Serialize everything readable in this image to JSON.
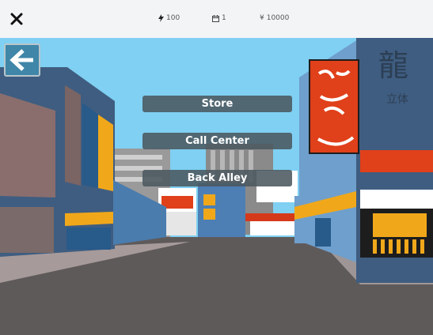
{
  "topbar": {
    "close_icon": "close-icon",
    "stats": [
      {
        "icon": "energy-bolt-icon",
        "value": "100"
      },
      {
        "icon": "calendar-icon",
        "value": "1"
      },
      {
        "icon": "yen-icon",
        "symbol": "¥",
        "value": "10000"
      }
    ]
  },
  "navigation": {
    "back_icon": "arrow-left-icon"
  },
  "menu": {
    "store": "Store",
    "call_center": "Call Center",
    "back_alley": "Back Alley"
  },
  "signs": {
    "top_right": "龍",
    "top_right_small": "立体"
  },
  "colors": {
    "sky": "#7fd0f2",
    "sign_red": "#e0401a",
    "sign_orange": "#f0a81a",
    "button_bg": "#4b5860",
    "back_button": "#3f86a8"
  }
}
